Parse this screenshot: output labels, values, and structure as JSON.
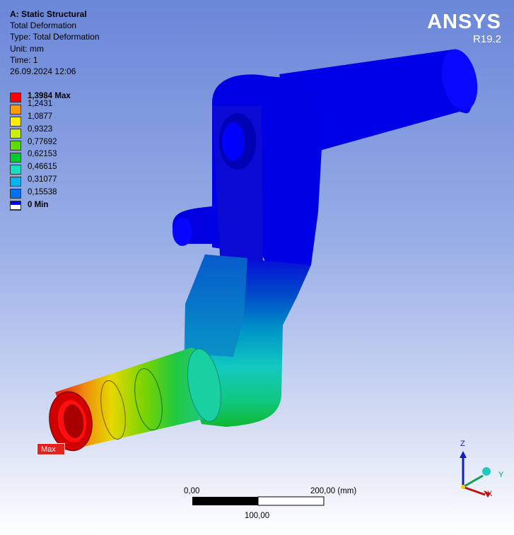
{
  "info": {
    "title": "A: Static Structural",
    "result": "Total Deformation",
    "type": "Type: Total Deformation",
    "unit": "Unit: mm",
    "time": "Time: 1",
    "datetime": "26.09.2024 12:06"
  },
  "brand": {
    "name": "ANSYS",
    "version": "R19.2"
  },
  "legend": [
    {
      "label": "1,3984 Max",
      "color": "#ff0000",
      "bold": true
    },
    {
      "label": "1,2431",
      "color": "#ff9a00",
      "bold": false
    },
    {
      "label": "1,0877",
      "color": "#ffee00",
      "bold": false
    },
    {
      "label": "0,9323",
      "color": "#c8f000",
      "bold": false
    },
    {
      "label": "0,77692",
      "color": "#5cdc00",
      "bold": false
    },
    {
      "label": "0,62153",
      "color": "#00cc30",
      "bold": false
    },
    {
      "label": "0,46615",
      "color": "#12e0c0",
      "bold": false
    },
    {
      "label": "0,31077",
      "color": "#00b4f0",
      "bold": false
    },
    {
      "label": "0,15538",
      "color": "#0070f0",
      "bold": false
    },
    {
      "label": "0 Min",
      "color": "#0000ff",
      "bold": true
    }
  ],
  "probe": {
    "label": "Max"
  },
  "scale": {
    "start": "0,00",
    "end": "200,00 (mm)",
    "mid": "100,00"
  },
  "triad": {
    "z": "Z",
    "y": "Y",
    "x": "X"
  }
}
